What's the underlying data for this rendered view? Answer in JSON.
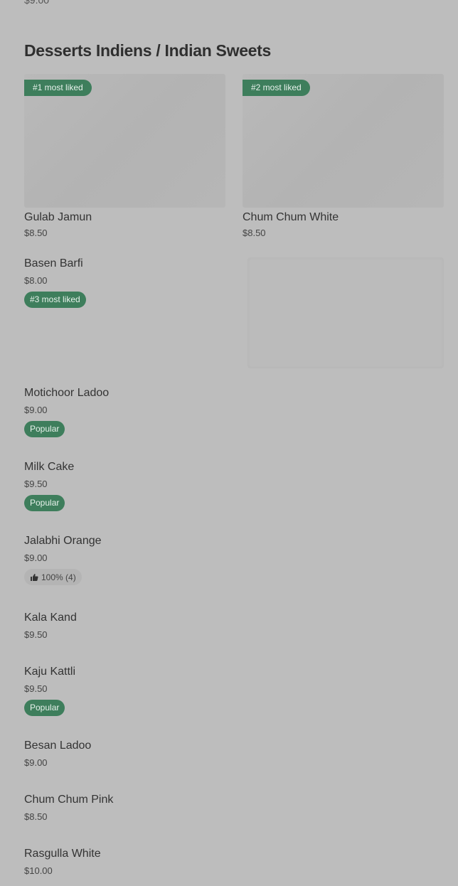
{
  "cutoff_price": "$9.00",
  "section": {
    "title": "Desserts Indiens / Indian Sweets"
  },
  "featured": [
    {
      "name": "Gulab Jamun",
      "price": "$8.50",
      "badge": "#1 most liked"
    },
    {
      "name": "Chum Chum White",
      "price": "$8.50",
      "badge": "#2 most liked"
    }
  ],
  "items": [
    {
      "name": "Basen Barfi",
      "price": "$8.00",
      "badge": "#3 most liked"
    },
    {
      "name": "Motichoor Ladoo",
      "price": "$9.00",
      "badge": "Popular"
    },
    {
      "name": "Milk Cake",
      "price": "$9.50",
      "badge": "Popular"
    },
    {
      "name": "Jalabhi Orange",
      "price": "$9.00",
      "rating": "100% (4)"
    },
    {
      "name": "Kala Kand",
      "price": "$9.50"
    },
    {
      "name": "Kaju Kattli",
      "price": "$9.50",
      "badge": "Popular"
    },
    {
      "name": "Besan Ladoo",
      "price": "$9.00"
    },
    {
      "name": "Chum Chum Pink",
      "price": "$8.50"
    },
    {
      "name": "Rasgulla White",
      "price": "$10.00"
    }
  ],
  "colors": {
    "background": "#bdbdbd",
    "badge": "#3e7e5c",
    "text": "#333333"
  },
  "icons": {
    "rating": "thumbs-up-icon"
  }
}
